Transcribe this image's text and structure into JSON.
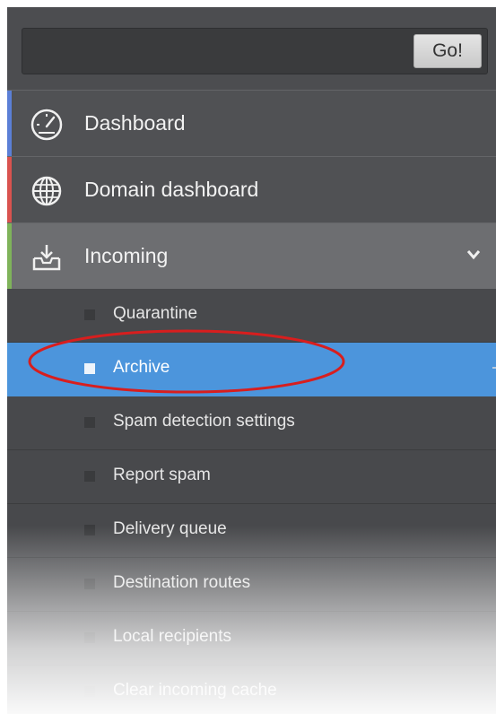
{
  "search": {
    "value": "",
    "placeholder": "",
    "go_label": "Go!"
  },
  "nav": {
    "dashboard": {
      "label": "Dashboard",
      "icon": "speedometer-icon",
      "accent": "#5b7fd6"
    },
    "domain_dashboard": {
      "label": "Domain dashboard",
      "icon": "globe-icon",
      "accent": "#d9534f"
    },
    "incoming": {
      "label": "Incoming",
      "icon": "inbox-download-icon",
      "accent": "#7fb35a",
      "expanded": true
    }
  },
  "submenu": [
    {
      "label": "Quarantine",
      "active": false
    },
    {
      "label": "Archive",
      "active": true
    },
    {
      "label": "Spam detection settings",
      "active": false
    },
    {
      "label": "Report spam",
      "active": false
    },
    {
      "label": "Delivery queue",
      "active": false
    },
    {
      "label": "Destination routes",
      "active": false
    },
    {
      "label": "Local recipients",
      "active": false
    },
    {
      "label": "Clear incoming cache",
      "active": false
    }
  ],
  "colors": {
    "sidebar_bg": "#4b4c4f",
    "active_item": "#4c95dc",
    "annotation": "#d81e1e"
  }
}
